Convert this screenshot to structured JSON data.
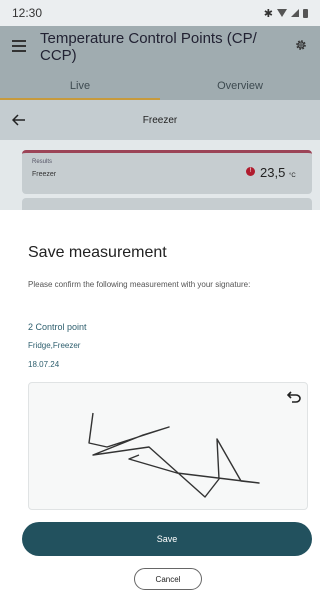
{
  "status_bar": {
    "time": "12:30",
    "bluetooth": "✱"
  },
  "app_bar": {
    "title": "Temperature Control Points (CP/ CCP)"
  },
  "tabs": [
    {
      "label": "Live"
    },
    {
      "label": "Overview"
    }
  ],
  "sub_header": {
    "title": "Freezer"
  },
  "results": {
    "label": "Results",
    "row_label": "Freezer",
    "value": "23,5",
    "unit": "°C",
    "warning_glyph": "!"
  },
  "sheet": {
    "title": "Save measurement",
    "description": "Please confirm the following measurement with your signature:",
    "control_points_count": "2 Control point",
    "control_points_names": "Fridge,Freezer",
    "date": "18.07.24",
    "save_label": "Save",
    "cancel_label": "Cancel"
  },
  "colors": {
    "accent": "#22515e",
    "warning": "#b01c2e",
    "tab_indicator": "#c79a3c"
  },
  "icons": {
    "menu": "menu-icon",
    "settings": "gear-icon",
    "back": "arrow-left-icon",
    "undo": "undo-icon"
  }
}
